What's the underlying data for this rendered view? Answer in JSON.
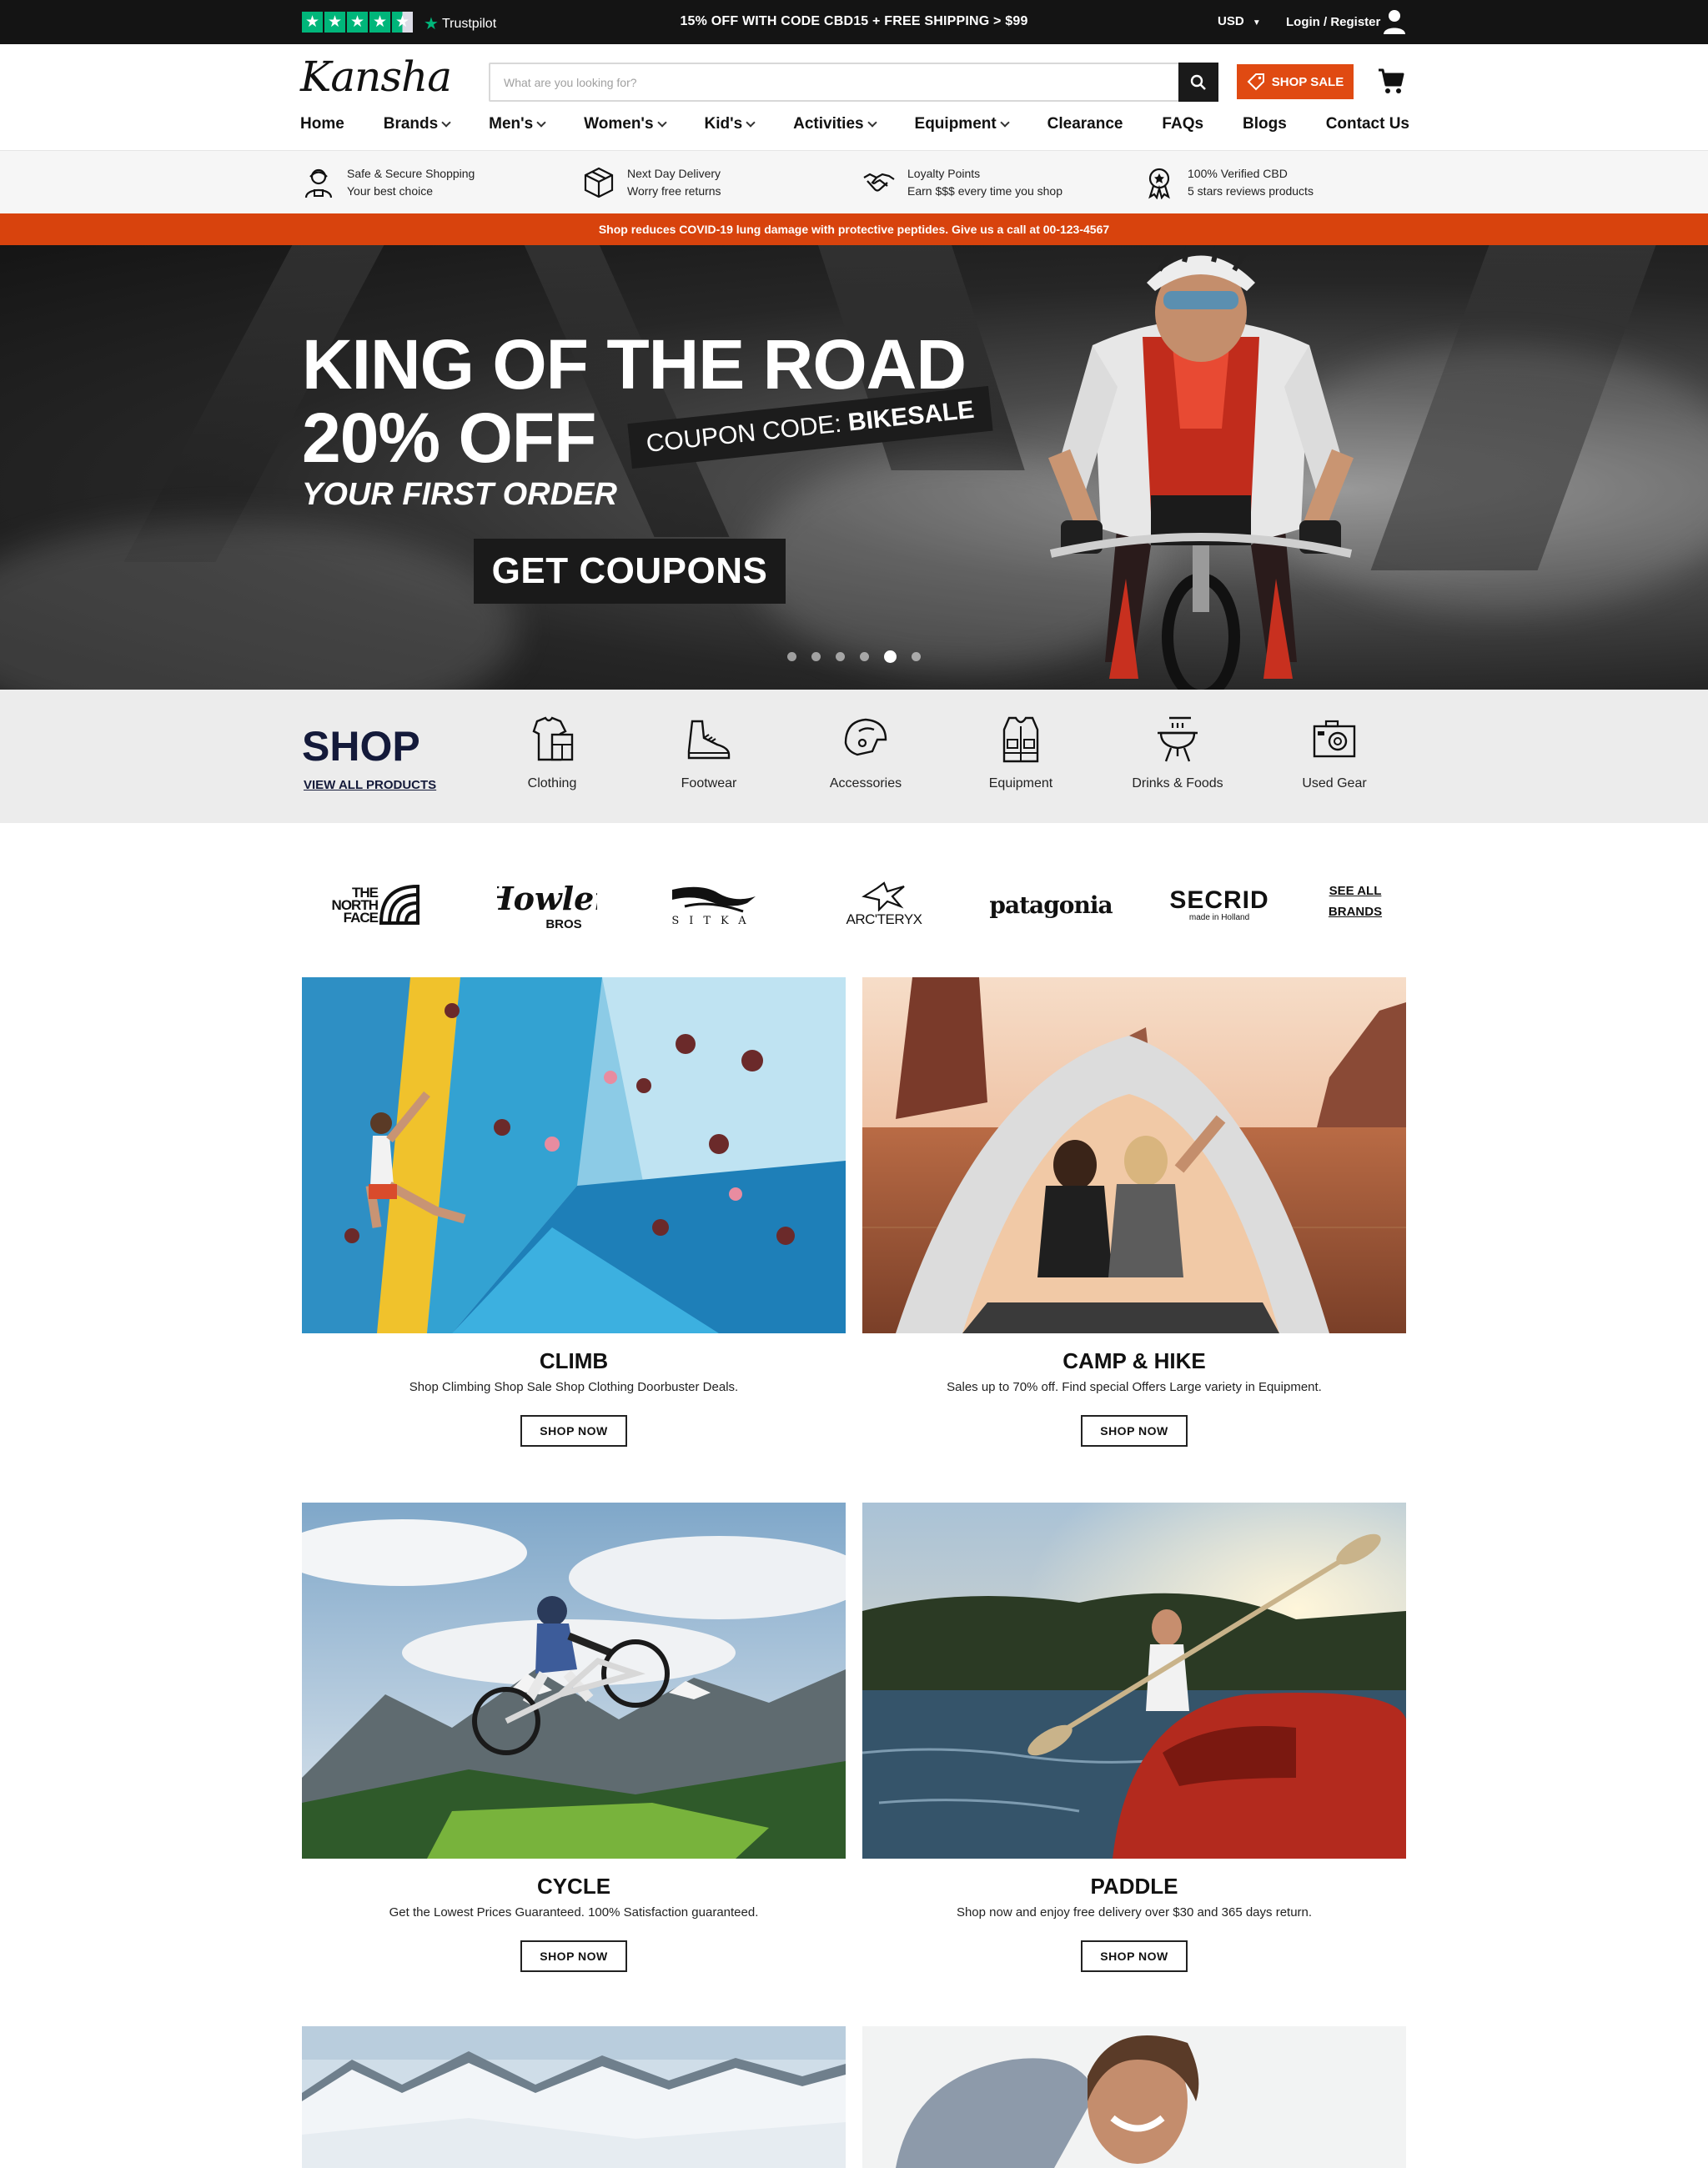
{
  "topbar": {
    "trustpilot_label": "Trustpilot",
    "promo": "15% OFF WITH CODE CBD15 + FREE SHIPPING > $99",
    "currency": "USD",
    "login": "Login / Register"
  },
  "header": {
    "logo": "Kansha",
    "search_placeholder": "What are you looking for?",
    "shop_sale": "SHOP SALE"
  },
  "nav": [
    {
      "label": "Home",
      "dropdown": false
    },
    {
      "label": "Brands",
      "dropdown": true
    },
    {
      "label": "Men's",
      "dropdown": true
    },
    {
      "label": "Women's",
      "dropdown": true
    },
    {
      "label": "Kid's",
      "dropdown": true
    },
    {
      "label": "Activities",
      "dropdown": true
    },
    {
      "label": "Equipment",
      "dropdown": true
    },
    {
      "label": "Clearance",
      "dropdown": false
    },
    {
      "label": "FAQs",
      "dropdown": false
    },
    {
      "label": "Blogs",
      "dropdown": false
    },
    {
      "label": "Contact Us",
      "dropdown": false
    }
  ],
  "features": [
    {
      "title": "Safe & Secure Shopping",
      "subtitle": "Your best choice",
      "icon": "secure-person-icon"
    },
    {
      "title": "Next Day Delivery",
      "subtitle": "Worry free returns",
      "icon": "box-icon"
    },
    {
      "title": "Loyalty Points",
      "subtitle": "Earn $$$ every time you shop",
      "icon": "handshake-icon"
    },
    {
      "title": "100% Verified CBD",
      "subtitle": "5 stars reviews products",
      "icon": "award-icon"
    }
  ],
  "covid_banner": "Shop reduces COVID-19 lung damage with protective peptides. Give us a call at 00-123-4567",
  "hero": {
    "line1": "KING OF THE ROAD",
    "line2": "20% OFF",
    "line3": "YOUR FIRST ORDER",
    "coupon_prefix": "COUPON CODE:",
    "coupon_code": "BIKESALE",
    "cta": "GET COUPONS",
    "slide_count": 6,
    "active_slide": 5
  },
  "shop": {
    "title": "SHOP",
    "view_all": "VIEW ALL PRODUCTS",
    "categories": [
      {
        "label": "Clothing",
        "icon": "clothing-icon"
      },
      {
        "label": "Footwear",
        "icon": "shoe-icon"
      },
      {
        "label": "Accessories",
        "icon": "helmet-icon"
      },
      {
        "label": "Equipment",
        "icon": "vest-icon"
      },
      {
        "label": "Drinks & Foods",
        "icon": "grill-icon"
      },
      {
        "label": "Used Gear",
        "icon": "camera-icon"
      }
    ]
  },
  "brands": {
    "items": [
      {
        "name": "THE NORTH FACE"
      },
      {
        "name": "Howler BROS"
      },
      {
        "name": "SITKA"
      },
      {
        "name": "ARC'TERYX"
      },
      {
        "name": "patagonia"
      },
      {
        "name": "SECRID",
        "tagline": "made in Holland"
      }
    ],
    "see_all": "SEE ALL BRANDS"
  },
  "tiles": [
    {
      "title": "CLIMB",
      "desc": "Shop Climbing Shop Sale Shop Clothing Doorbuster Deals.",
      "button": "SHOP NOW"
    },
    {
      "title": "CAMP & HIKE",
      "desc": "Sales up to 70% off. Find special Offers Large variety in Equipment.",
      "button": "SHOP NOW"
    },
    {
      "title": "CYCLE",
      "desc": "Get the Lowest Prices Guaranteed. 100% Satisfaction guaranteed.",
      "button": "SHOP NOW"
    },
    {
      "title": "PADDLE",
      "desc": "Shop now and enjoy free delivery over $30 and 365 days return.",
      "button": "SHOP NOW"
    }
  ],
  "colors": {
    "accent": "#e04a12",
    "topbar": "#141414",
    "trustpilot": "#00b67a",
    "shop_navy": "#141a3a"
  }
}
